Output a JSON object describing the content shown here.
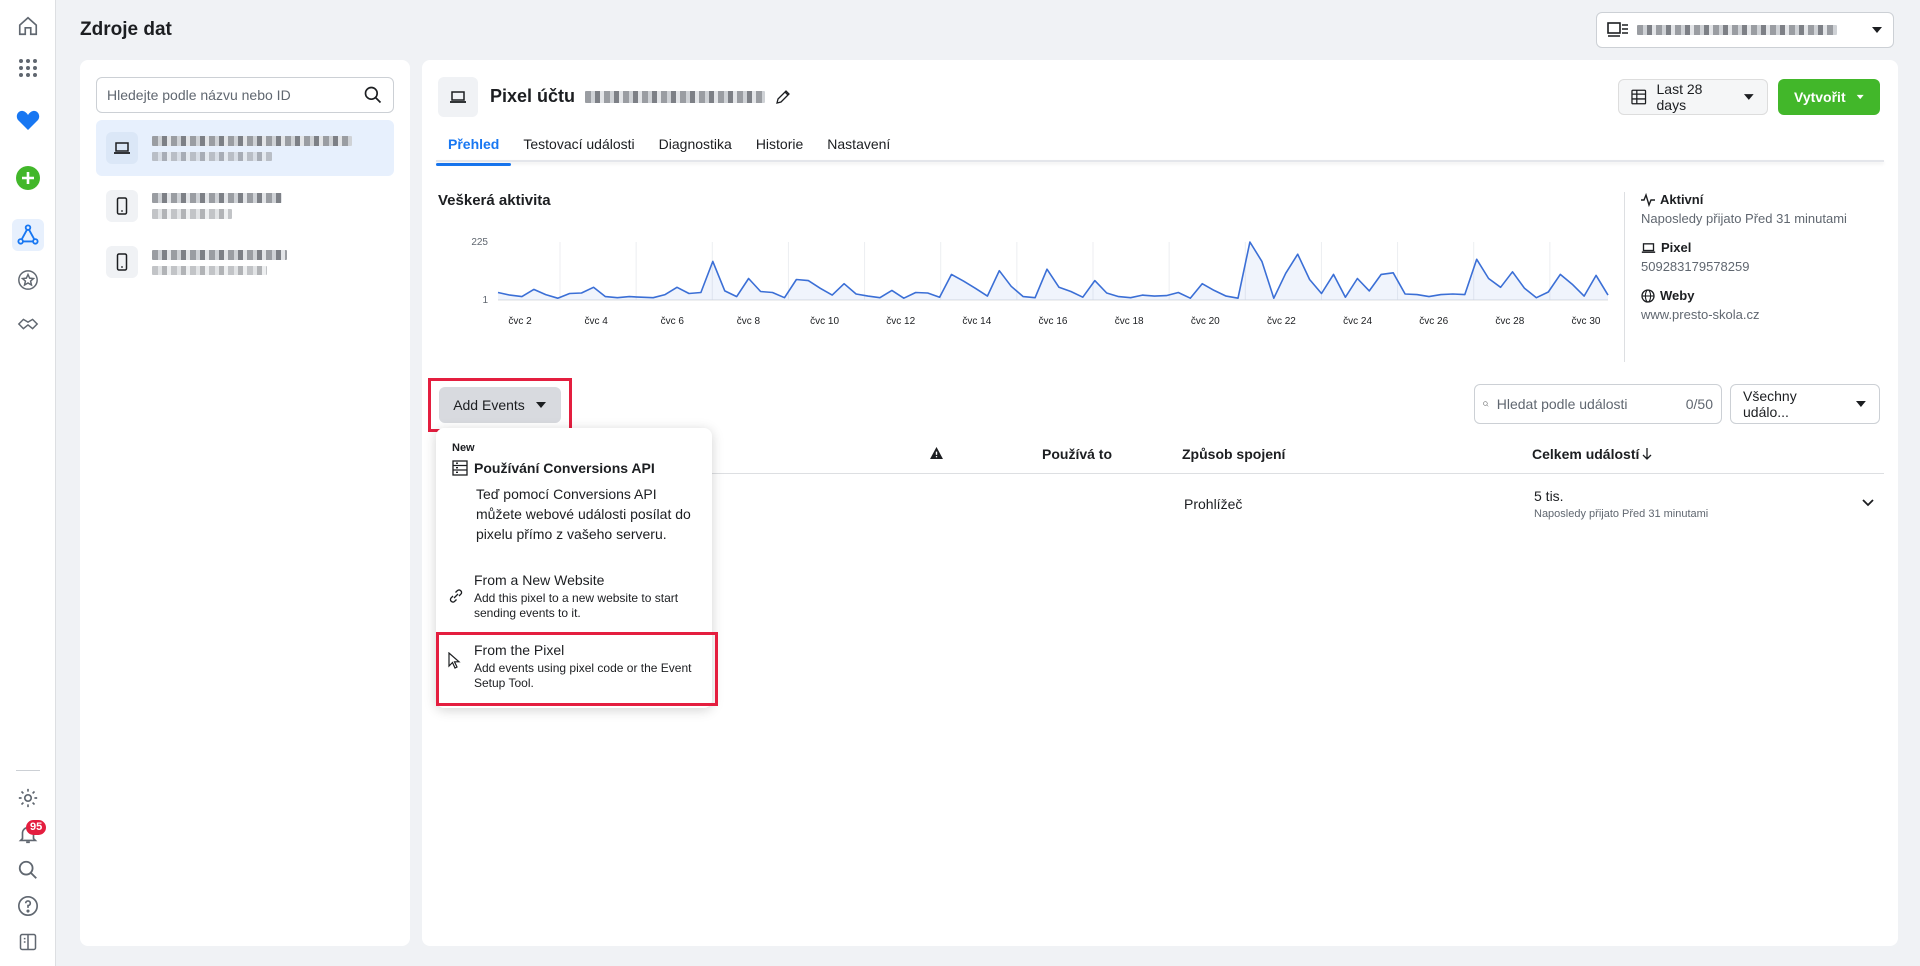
{
  "page": {
    "title": "Zdroje dat"
  },
  "colors": {
    "accent": "#1877f2",
    "create_green": "#42b72a",
    "highlight_red": "#e41e3f",
    "chart_line": "#3b6fd6"
  },
  "rail": {
    "icons": [
      "home-icon",
      "apps-grid-icon",
      "heart-icon",
      "add-icon",
      "data-sources-icon",
      "star-icon",
      "handshake-icon",
      "settings-icon",
      "bell-icon",
      "search-icon",
      "help-icon",
      "panel-icon"
    ],
    "notification_count": "95"
  },
  "left_panel": {
    "search_placeholder": "Hledejte podle názvu nebo ID"
  },
  "main": {
    "pixel_title": "Pixel účtu",
    "date_range": "Last 28 days",
    "create_label": "Vytvořit",
    "tabs": [
      {
        "label": "Přehled"
      },
      {
        "label": "Testovací události"
      },
      {
        "label": "Diagnostika"
      },
      {
        "label": "Historie"
      },
      {
        "label": "Nastavení"
      }
    ],
    "activity_title": "Veškerá aktivita",
    "side": {
      "status_label": "Aktivní",
      "status_detail": "Naposledy přijato Před 31 minutami",
      "pixel_label": "Pixel",
      "pixel_id": "509283179578259",
      "web_label": "Weby",
      "web_url": "www.presto-skola.cz"
    },
    "add_events_label": "Add Events",
    "events_search_placeholder": "Hledat podle události",
    "events_count": "0/50",
    "events_filter": "Všechny událo...",
    "table": {
      "headers": [
        "Používá to",
        "Způsob spojení",
        "Celkem událostí"
      ],
      "row": {
        "connection": "Prohlížeč",
        "total": "5 tis.",
        "last_received": "Naposledy přijato Před 31 minutami"
      }
    }
  },
  "dropdown": {
    "new_badge": "New",
    "capi_title": "Používání Conversions API",
    "capi_desc": "Teď pomocí Conversions API můžete webové události posílat do pixelu přímo z vašeho serveru.",
    "items": [
      {
        "title": "From a New Website",
        "desc": "Add this pixel to a new website to start sending events to it."
      },
      {
        "title": "From the Pixel",
        "desc": "Add events using pixel code or the Event Setup Tool."
      }
    ]
  },
  "chart_data": {
    "type": "line",
    "title": "",
    "ylim": [
      1,
      225
    ],
    "yticks": [
      "225",
      "1"
    ],
    "x_tick_labels": [
      "čvc 2",
      "čvc 4",
      "čvc 6",
      "čvc 8",
      "čvc 10",
      "čvc 12",
      "čvc 14",
      "čvc 16",
      "čvc 18",
      "čvc 20",
      "čvc 22",
      "čvc 24",
      "čvc 26",
      "čvc 28",
      "čvc 30"
    ],
    "series": [
      {
        "values": [
          30,
          20,
          14,
          42,
          22,
          8,
          26,
          28,
          50,
          14,
          10,
          14,
          12,
          10,
          22,
          50,
          26,
          30,
          150,
          36,
          14,
          84,
          34,
          30,
          10,
          80,
          76,
          46,
          20,
          64,
          24,
          16,
          10,
          38,
          8,
          30,
          28,
          12,
          100,
          74,
          46,
          16,
          114,
          54,
          14,
          10,
          120,
          50,
          34,
          12,
          76,
          28,
          14,
          10,
          20,
          16,
          18,
          30,
          8,
          64,
          38,
          16,
          8,
          232,
          150,
          8,
          104,
          178,
          80,
          26,
          100,
          12,
          84,
          36,
          100,
          106,
          24,
          22,
          14,
          22,
          24,
          22,
          158,
          84,
          50,
          110,
          46,
          10,
          32,
          100,
          62,
          16,
          96,
          20
        ]
      }
    ]
  }
}
